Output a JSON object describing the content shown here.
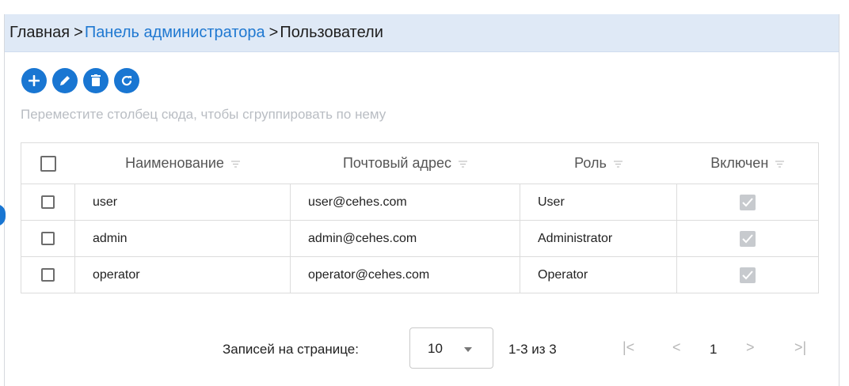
{
  "breadcrumb": {
    "home": "Главная",
    "separator": ">",
    "admin_panel": "Панель администратора",
    "current": "Пользователи"
  },
  "toolbar": {
    "buttons": [
      {
        "name": "add",
        "icon": "plus-icon"
      },
      {
        "name": "edit",
        "icon": "pencil-icon"
      },
      {
        "name": "delete",
        "icon": "trash-icon"
      },
      {
        "name": "refresh",
        "icon": "refresh-icon"
      }
    ],
    "accent": "#1976d2"
  },
  "group_hint": "Переместите столбец сюда, чтобы сгруппировать по нему",
  "table": {
    "columns": [
      "Наименование",
      "Почтовый адрес",
      "Роль",
      "Включен"
    ],
    "rows": [
      {
        "name": "user",
        "email": "user@cehes.com",
        "role": "User",
        "enabled": true
      },
      {
        "name": "admin",
        "email": "admin@cehes.com",
        "role": "Administrator",
        "enabled": true
      },
      {
        "name": "operator",
        "email": "operator@cehes.com",
        "role": "Operator",
        "enabled": true
      }
    ]
  },
  "pager": {
    "per_page_label": "Записей на странице:",
    "per_page_value": "10",
    "range_info": "1-3 из 3",
    "current_page": "1",
    "first_glyph": "|<",
    "prev_glyph": "<",
    "next_glyph": ">",
    "last_glyph": ">|"
  }
}
